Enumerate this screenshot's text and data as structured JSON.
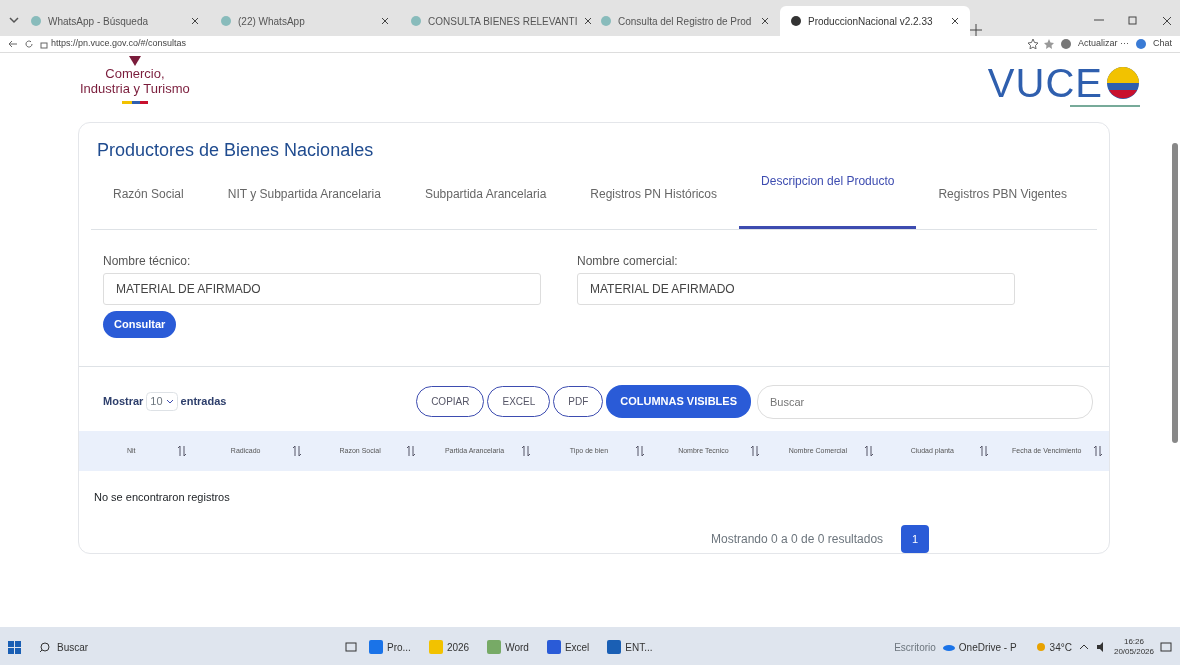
{
  "browser": {
    "tabs": [
      {
        "title": "WhatsApp - Búsqueda",
        "selected": false
      },
      {
        "title": "(22) WhatsApp",
        "selected": false
      },
      {
        "title": "CONSULTA BIENES RELEVANTI",
        "selected": false
      },
      {
        "title": "Consulta del Registro de Prod",
        "selected": false
      },
      {
        "title": "ProduccionNacional v2.2.33",
        "selected": true
      }
    ],
    "url": "https://pn.vuce.gov.co/#/consultas",
    "update_label": "Actualizar ···",
    "chat_label": "Chat"
  },
  "header": {
    "ministry_lines": [
      "Comercio,",
      "Industria y Turismo"
    ],
    "logo_text": "VUCE"
  },
  "card": {
    "title": "Productores de Bienes Nacionales",
    "tabs": [
      {
        "label": "Razón Social",
        "selected": false
      },
      {
        "label": "NIT y Subpartida Arancelaria",
        "selected": false
      },
      {
        "label": "Subpartida Arancelaria",
        "selected": false
      },
      {
        "label": "Registros PN Históricos",
        "selected": false
      },
      {
        "label": "Descripcion del Producto",
        "selected": true
      },
      {
        "label": "Registros PBN Vigentes",
        "selected": false
      }
    ],
    "fields": [
      {
        "label": "Nombre técnico:",
        "value": "MATERIAL DE AFIRMADO"
      },
      {
        "label": "Nombre comercial:",
        "value": "MATERIAL DE AFIRMADO"
      }
    ],
    "submit": "Consultar",
    "length_menu": {
      "before": "Mostrar",
      "value": "10",
      "after": "entradas"
    },
    "export_buttons": [
      {
        "label": "COPIAR",
        "kind": "outline"
      },
      {
        "label": "EXCEL",
        "kind": "outline"
      },
      {
        "label": "PDF",
        "kind": "outline"
      },
      {
        "label": "COLUMNAS VISIBLES",
        "kind": "filled"
      }
    ],
    "search": {
      "placeholder": "Buscar"
    },
    "table": {
      "columns": [
        "Nit",
        "Radicado",
        "Razon Social",
        "Partida Arancelaria",
        "Tipo de bien",
        "Nombre Tecnico",
        "Nombre Comercial",
        "Ciudad planta",
        "Fecha de Vencimiento"
      ],
      "empty_message": "No se encontraron registros"
    },
    "pagination": {
      "info": "Mostrando 0 a 0 de 0 resultados",
      "pages": [
        {
          "label": "1",
          "selected": true
        }
      ]
    }
  },
  "taskbar": {
    "search": "Buscar",
    "apps": [
      "Pro...",
      "2026",
      "Word",
      "Excel",
      "ENT..."
    ],
    "desktop_label": "Escritorio",
    "onedrive_label": "OneDrive - P",
    "weather": "34°C",
    "time": "16:26",
    "date": "20/05/2026"
  }
}
